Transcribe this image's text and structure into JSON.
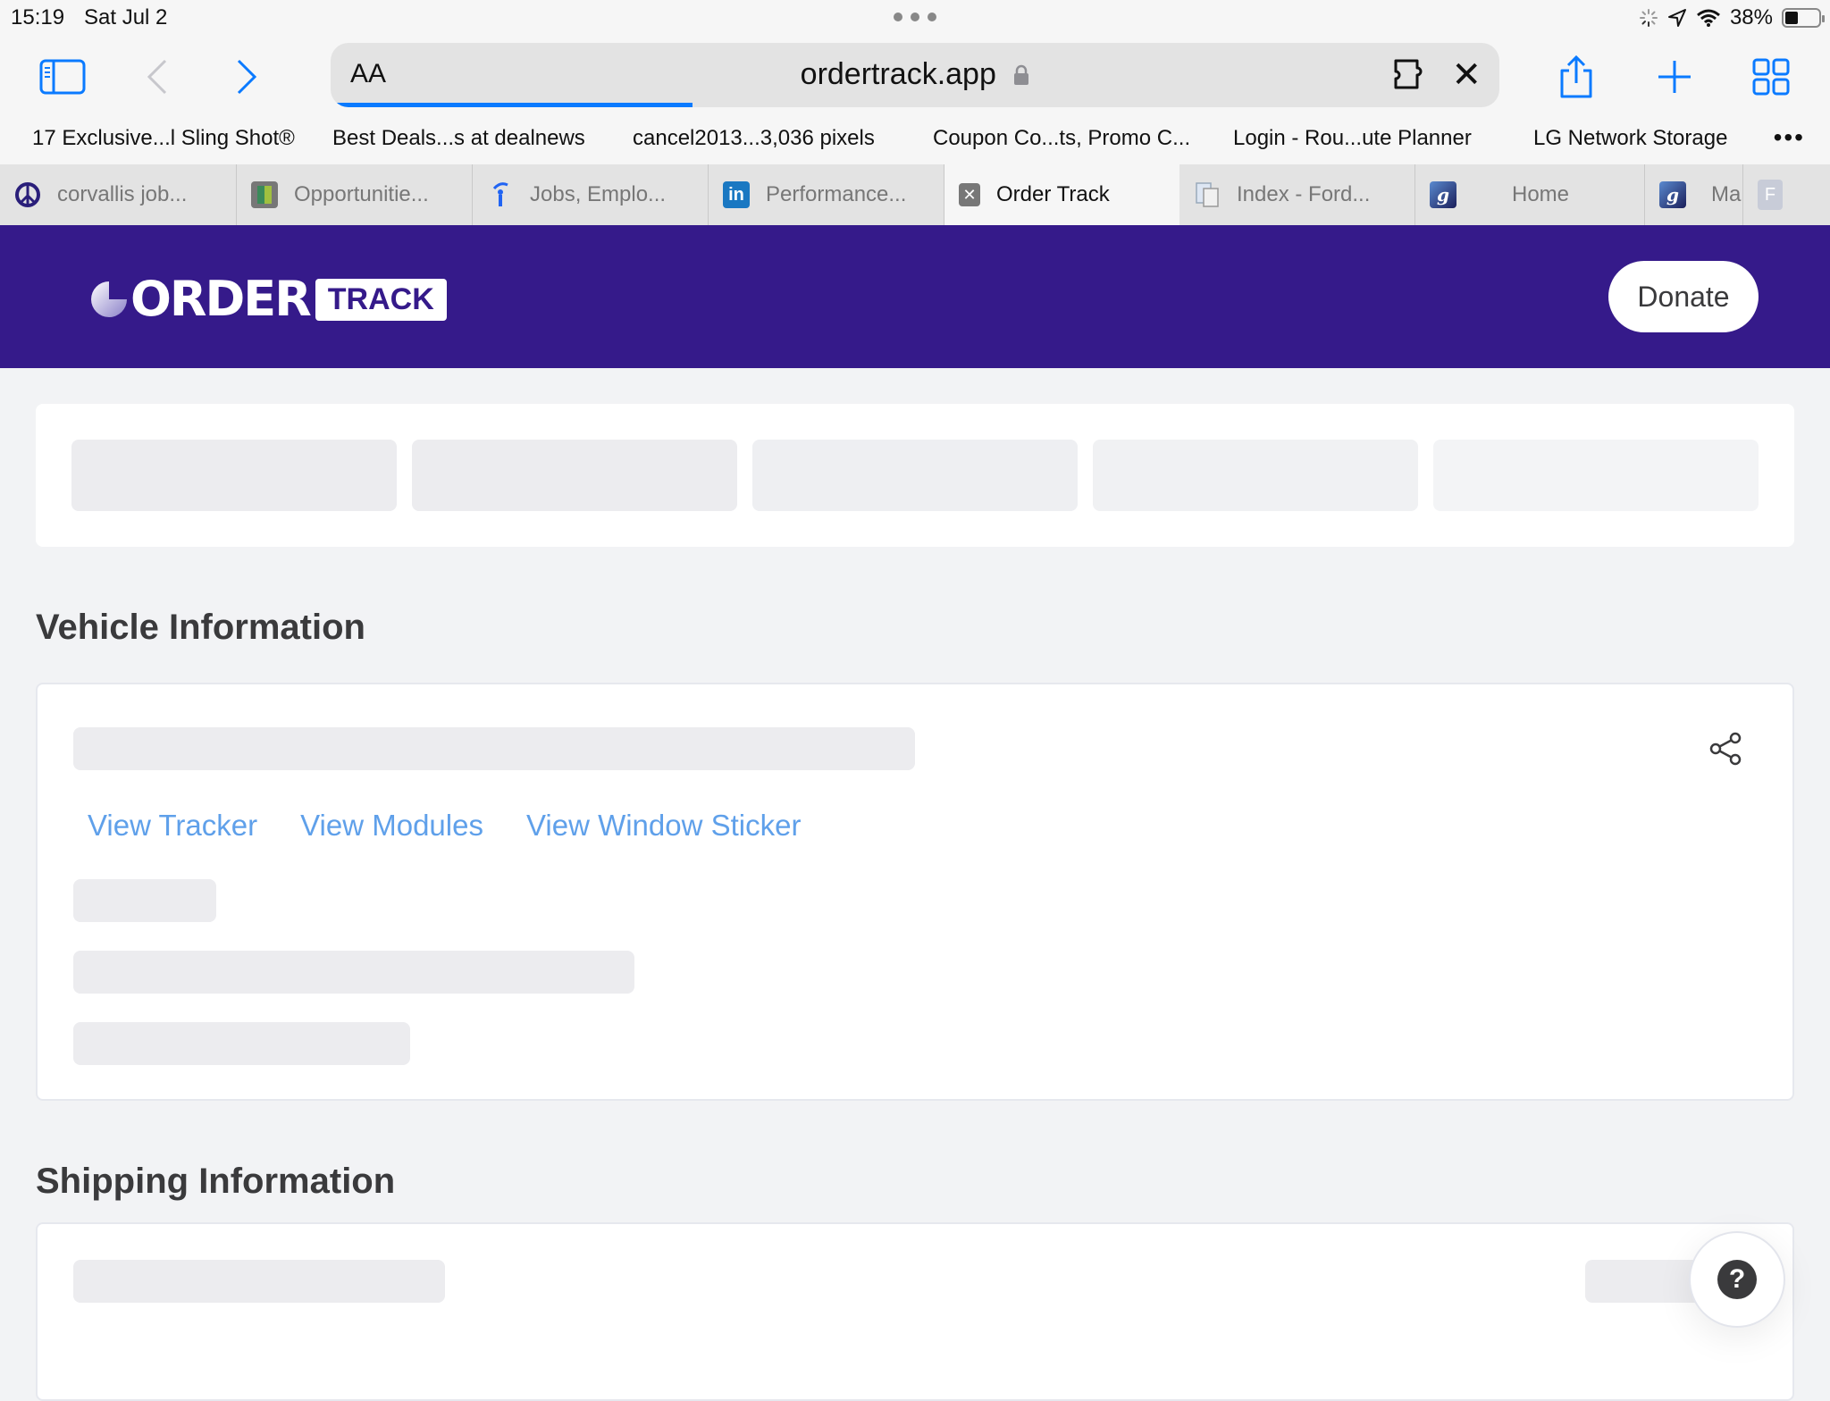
{
  "status_bar": {
    "time": "15:19",
    "date": "Sat Jul 2",
    "battery_text": "38%",
    "battery_level": 0.38
  },
  "toolbar": {
    "text_size_label": "AA",
    "url": "ordertrack.app",
    "page_load_progress": 0.31,
    "accent_color": "#0a7aff"
  },
  "bookmarks": [
    "17 Exclusive...l Sling Shot®",
    "Best Deals...s at dealnews",
    "cancel2013...3,036 pixels",
    "Coupon Co...ts, Promo C...",
    "Login - Rou...ute Planner",
    "LG Network Storage"
  ],
  "bookmarks_more": "•••",
  "tabs": [
    {
      "title": "corvallis job...",
      "icon": "peace-icon"
    },
    {
      "title": "Opportunitie...",
      "icon": "grid-favicon-icon"
    },
    {
      "title": "Jobs, Emplo...",
      "icon": "indeed-icon"
    },
    {
      "title": "Performance...",
      "icon": "linkedin-icon"
    },
    {
      "title": "Order Track",
      "icon": "close-tab-icon",
      "active": true
    },
    {
      "title": "Index - Ford...",
      "icon": "document-icon"
    },
    {
      "title": "Home",
      "icon": "ford-script-icon"
    },
    {
      "title": "Ma",
      "icon": "ford-script-icon"
    },
    {
      "title": "F",
      "icon": "letter-f-icon"
    }
  ],
  "site": {
    "brand_color": "#351a8a",
    "logo_word": "ORDER",
    "logo_track": "TRACK",
    "donate_label": "Donate"
  },
  "vehicle": {
    "title": "Vehicle Information",
    "links": [
      "View Tracker",
      "View Modules",
      "View Window Sticker"
    ],
    "link_color": "#5fa0ea"
  },
  "shipping": {
    "title": "Shipping Information"
  },
  "help_label": "?"
}
